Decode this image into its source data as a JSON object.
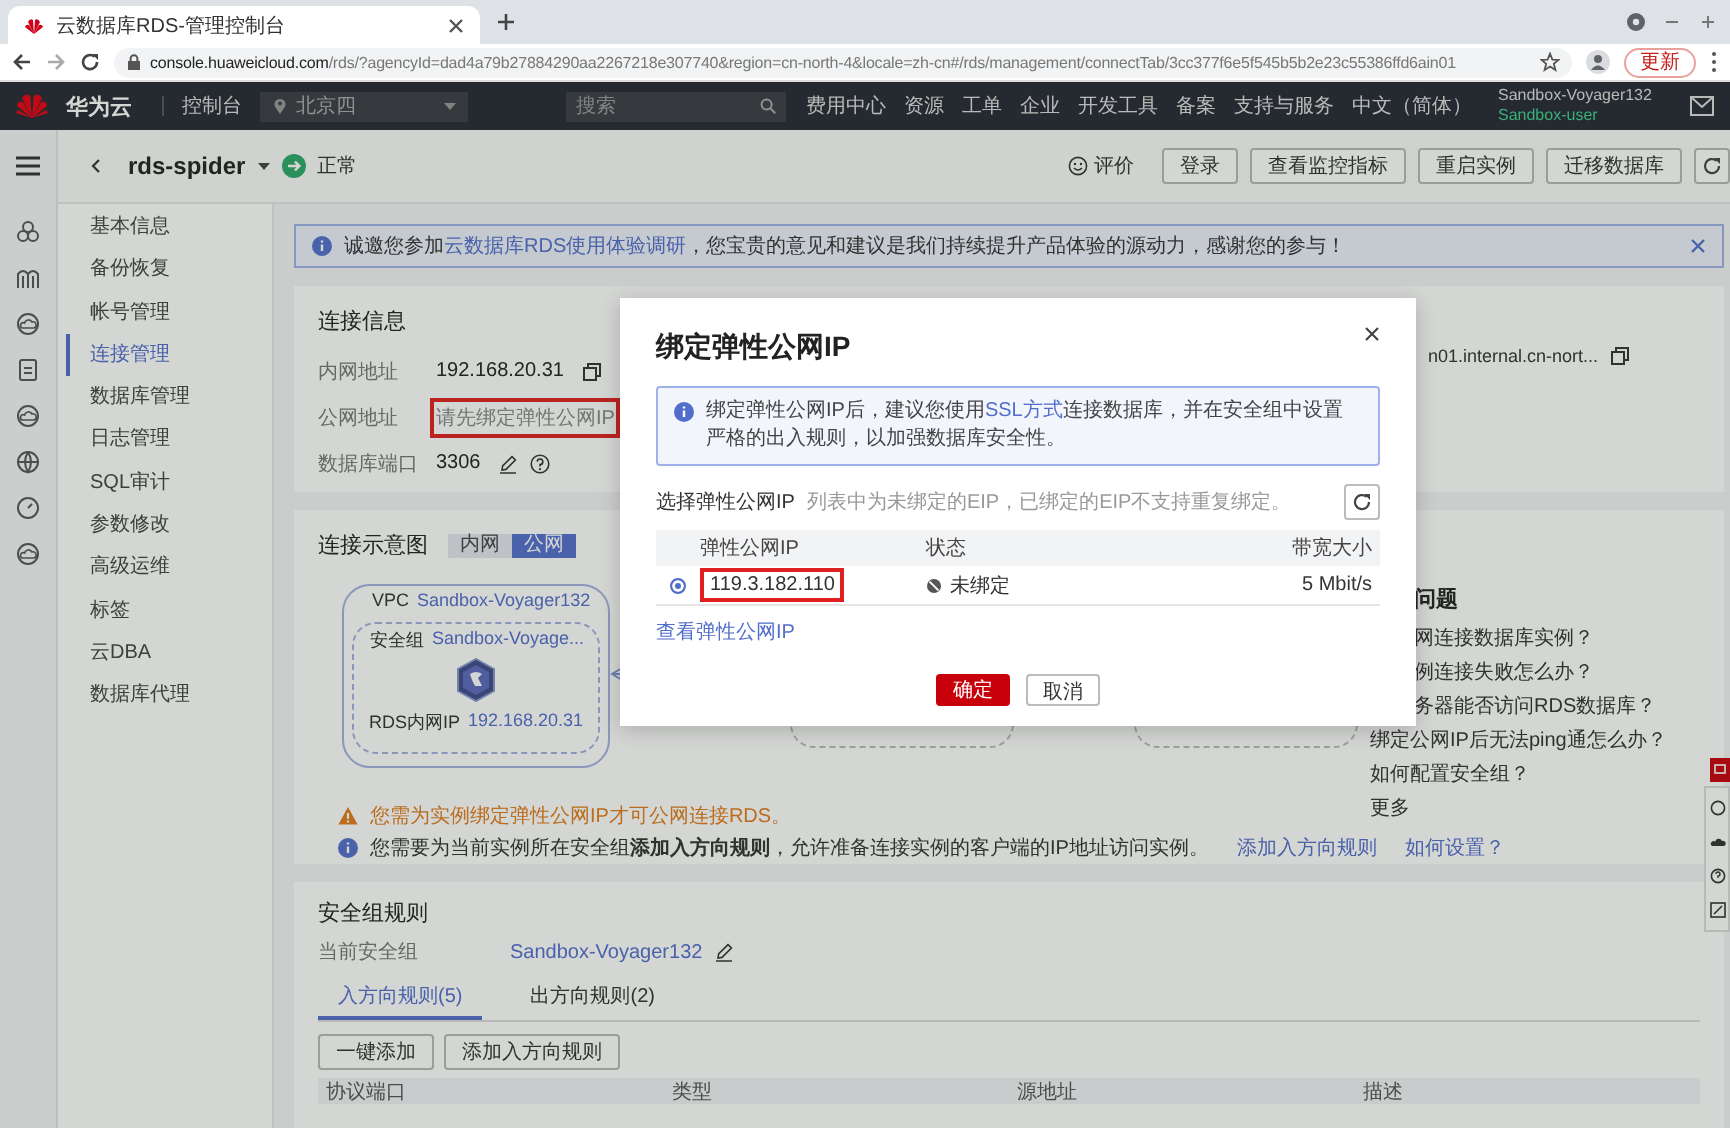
{
  "browser": {
    "tab_title": "云数据库RDS-管理控制台",
    "url_host": "console.huaweicloud.com",
    "url_rest": "/rds/?agencyId=dad4a79b27884290aa2267218e307740&region=cn-north-4&locale=zh-cn#/rds/management/connectTab/3cc377f6e5f545b5b2e23c55386ffd6ain01",
    "update_button": "更新"
  },
  "top_nav": {
    "brand": "华为云",
    "console": "控制台",
    "region": "北京四",
    "search_placeholder": "搜索",
    "links": [
      "费用中心",
      "资源",
      "工单",
      "企业",
      "开发工具",
      "备案",
      "支持与服务",
      "中文（简体）"
    ],
    "account": "Sandbox-Voyager132",
    "user": "Sandbox-user"
  },
  "instance": {
    "name": "rds-spider",
    "status": "正常",
    "actions": [
      {
        "label": "评价",
        "kind": "link"
      },
      {
        "label": "登录",
        "kind": "button"
      },
      {
        "label": "查看监控指标",
        "kind": "button"
      },
      {
        "label": "重启实例",
        "kind": "button"
      },
      {
        "label": "迁移数据库",
        "kind": "button"
      }
    ]
  },
  "sidebar": {
    "items": [
      {
        "label": "基本信息",
        "selected": false
      },
      {
        "label": "备份恢复",
        "selected": false
      },
      {
        "label": "帐号管理",
        "selected": false
      },
      {
        "label": "连接管理",
        "selected": true
      },
      {
        "label": "数据库管理",
        "selected": false
      },
      {
        "label": "日志管理",
        "selected": false
      },
      {
        "label": "SQL审计",
        "selected": false
      },
      {
        "label": "参数修改",
        "selected": false
      },
      {
        "label": "高级运维",
        "selected": false
      },
      {
        "label": "标签",
        "selected": false
      },
      {
        "label": "云DBA",
        "selected": false
      },
      {
        "label": "数据库代理",
        "selected": false
      }
    ]
  },
  "notice": {
    "before": "诚邀您参加",
    "link": "云数据库RDS使用体验调研",
    "after": "，您宝贵的意见和建议是我们持续提升产品体验的源动力，感谢您的参与！"
  },
  "connection_info": {
    "title": "连接信息",
    "rows": [
      {
        "label": "内网地址",
        "value": "192.168.20.31",
        "kind": "copy",
        "highlighted": false
      },
      {
        "label": "公网地址",
        "value": "请先绑定弹性公网IP",
        "kind": "empty",
        "highlighted": true
      },
      {
        "label": "数据库端口",
        "value": "3306",
        "kind": "edit",
        "highlighted": false
      }
    ],
    "column_2_value": "n01.internal.cn-nort..."
  },
  "diagram": {
    "title": "连接示意图",
    "toggle": [
      {
        "label": "内网",
        "selected": false
      },
      {
        "label": "公网",
        "selected": true
      }
    ],
    "vpc_label": "VPC",
    "vpc_name": "Sandbox-Voyager132",
    "sg_label": "安全组",
    "sg_name": "Sandbox-Voyage...",
    "rds_label": "RDS内网IP",
    "rds_ip": "192.168.20.31",
    "warning": "您需为实例绑定弹性公网IP才可公网连接RDS。",
    "info": "您需要为当前实例所在安全组**添加入方向规则**，允许准备连接实例的客户端的IP地址访问实例。",
    "info_links": [
      "添加入方向规则",
      "如何设置？"
    ]
  },
  "faq": {
    "title": "问题",
    "items": [
      "网连接数据库实例？",
      "例连接失败怎么办？",
      "务器能否访问RDS数据库？",
      "绑定公网IP后无法ping通怎么办？",
      "如何配置安全组？"
    ],
    "more": "更多"
  },
  "security_group": {
    "title": "安全组规则",
    "current_label": "当前安全组",
    "current_value": "Sandbox-Voyager132",
    "tabs": [
      {
        "label": "入方向规则(5)",
        "selected": true
      },
      {
        "label": "出方向规则(2)",
        "selected": false
      }
    ],
    "buttons": [
      "一键添加",
      "添加入方向规则"
    ],
    "columns": [
      "协议端口",
      "类型",
      "源地址",
      "描述"
    ]
  },
  "dialog": {
    "title": "绑定弹性公网IP",
    "info_before": "绑定弹性公网IP后，建议您使用",
    "info_link": "SSL方式",
    "info_after": "连接数据库，并在安全组中设置严格的出入规则，以加强数据库安全性。",
    "select_label": "选择弹性公网IP",
    "select_hint": "列表中为未绑定的EIP，已绑定的EIP不支持重复绑定。",
    "columns": [
      "弹性公网IP",
      "状态",
      "带宽大小"
    ],
    "rows": [
      {
        "ip": "119.3.182.110",
        "status": "未绑定",
        "bandwidth": "5 Mbit/s",
        "selected": true,
        "highlighted": true
      }
    ],
    "view_link": "查看弹性公网IP",
    "confirm": "确定",
    "cancel": "取消"
  }
}
